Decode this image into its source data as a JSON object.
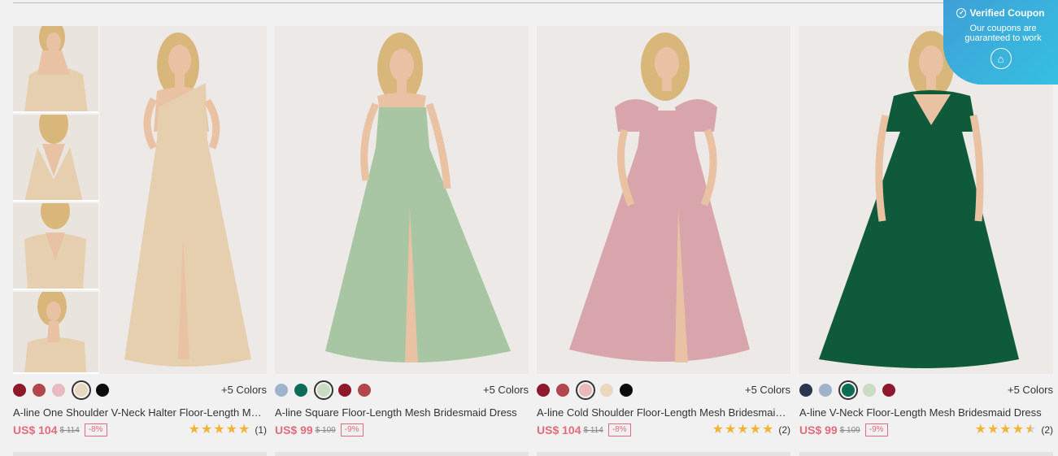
{
  "coupon": {
    "title": "Verified Coupon",
    "text": "Our coupons are guaranteed to work",
    "icon": "coupon-icon"
  },
  "products": [
    {
      "title": "A-line One Shoulder V-Neck Halter Floor-Length Mesh Bridesmaid Dress",
      "price": "US$ 104",
      "old_price": "$ 114",
      "discount": "-8%",
      "rating_count": "(1)",
      "rating": 5,
      "more_colors": "+5 Colors",
      "dress_color": "#e9d3b6",
      "swatches": [
        "#8c1a2c",
        "#b2474b",
        "#e8b9bd",
        "#ead7bf",
        "#0b0b0b"
      ],
      "selected_swatch": 3
    },
    {
      "title": "A-line Square Floor-Length Mesh Bridesmaid Dress",
      "price": "US$ 99",
      "old_price": "$ 109",
      "discount": "-9%",
      "rating_count": "",
      "rating": 0,
      "more_colors": "+5 Colors",
      "dress_color": "#a9c6a4",
      "swatches": [
        "#9fb3c9",
        "#0e6b55",
        "#c8dcc2",
        "#8c1a2c",
        "#b2474b"
      ],
      "selected_swatch": 2
    },
    {
      "title": "A-line Cold Shoulder Floor-Length Mesh Bridesmaid Dress",
      "price": "US$ 104",
      "old_price": "$ 114",
      "discount": "-8%",
      "rating_count": "(2)",
      "rating": 5,
      "more_colors": "+5 Colors",
      "dress_color": "#d7a5ab",
      "swatches": [
        "#8c1a2c",
        "#b2474b",
        "#e8b9bd",
        "#ead7bf",
        "#0b0b0b"
      ],
      "selected_swatch": 2
    },
    {
      "title": "A-line V-Neck Floor-Length Mesh Bridesmaid Dress",
      "price": "US$ 99",
      "old_price": "$ 109",
      "discount": "-9%",
      "rating_count": "(2)",
      "rating": 4.5,
      "more_colors": "+5 Colors",
      "dress_color": "#0f5a3a",
      "swatches": [
        "#2a3550",
        "#9fb3c9",
        "#0e6b55",
        "#c8dcc2",
        "#8c1a2c"
      ],
      "selected_swatch": 2
    }
  ]
}
